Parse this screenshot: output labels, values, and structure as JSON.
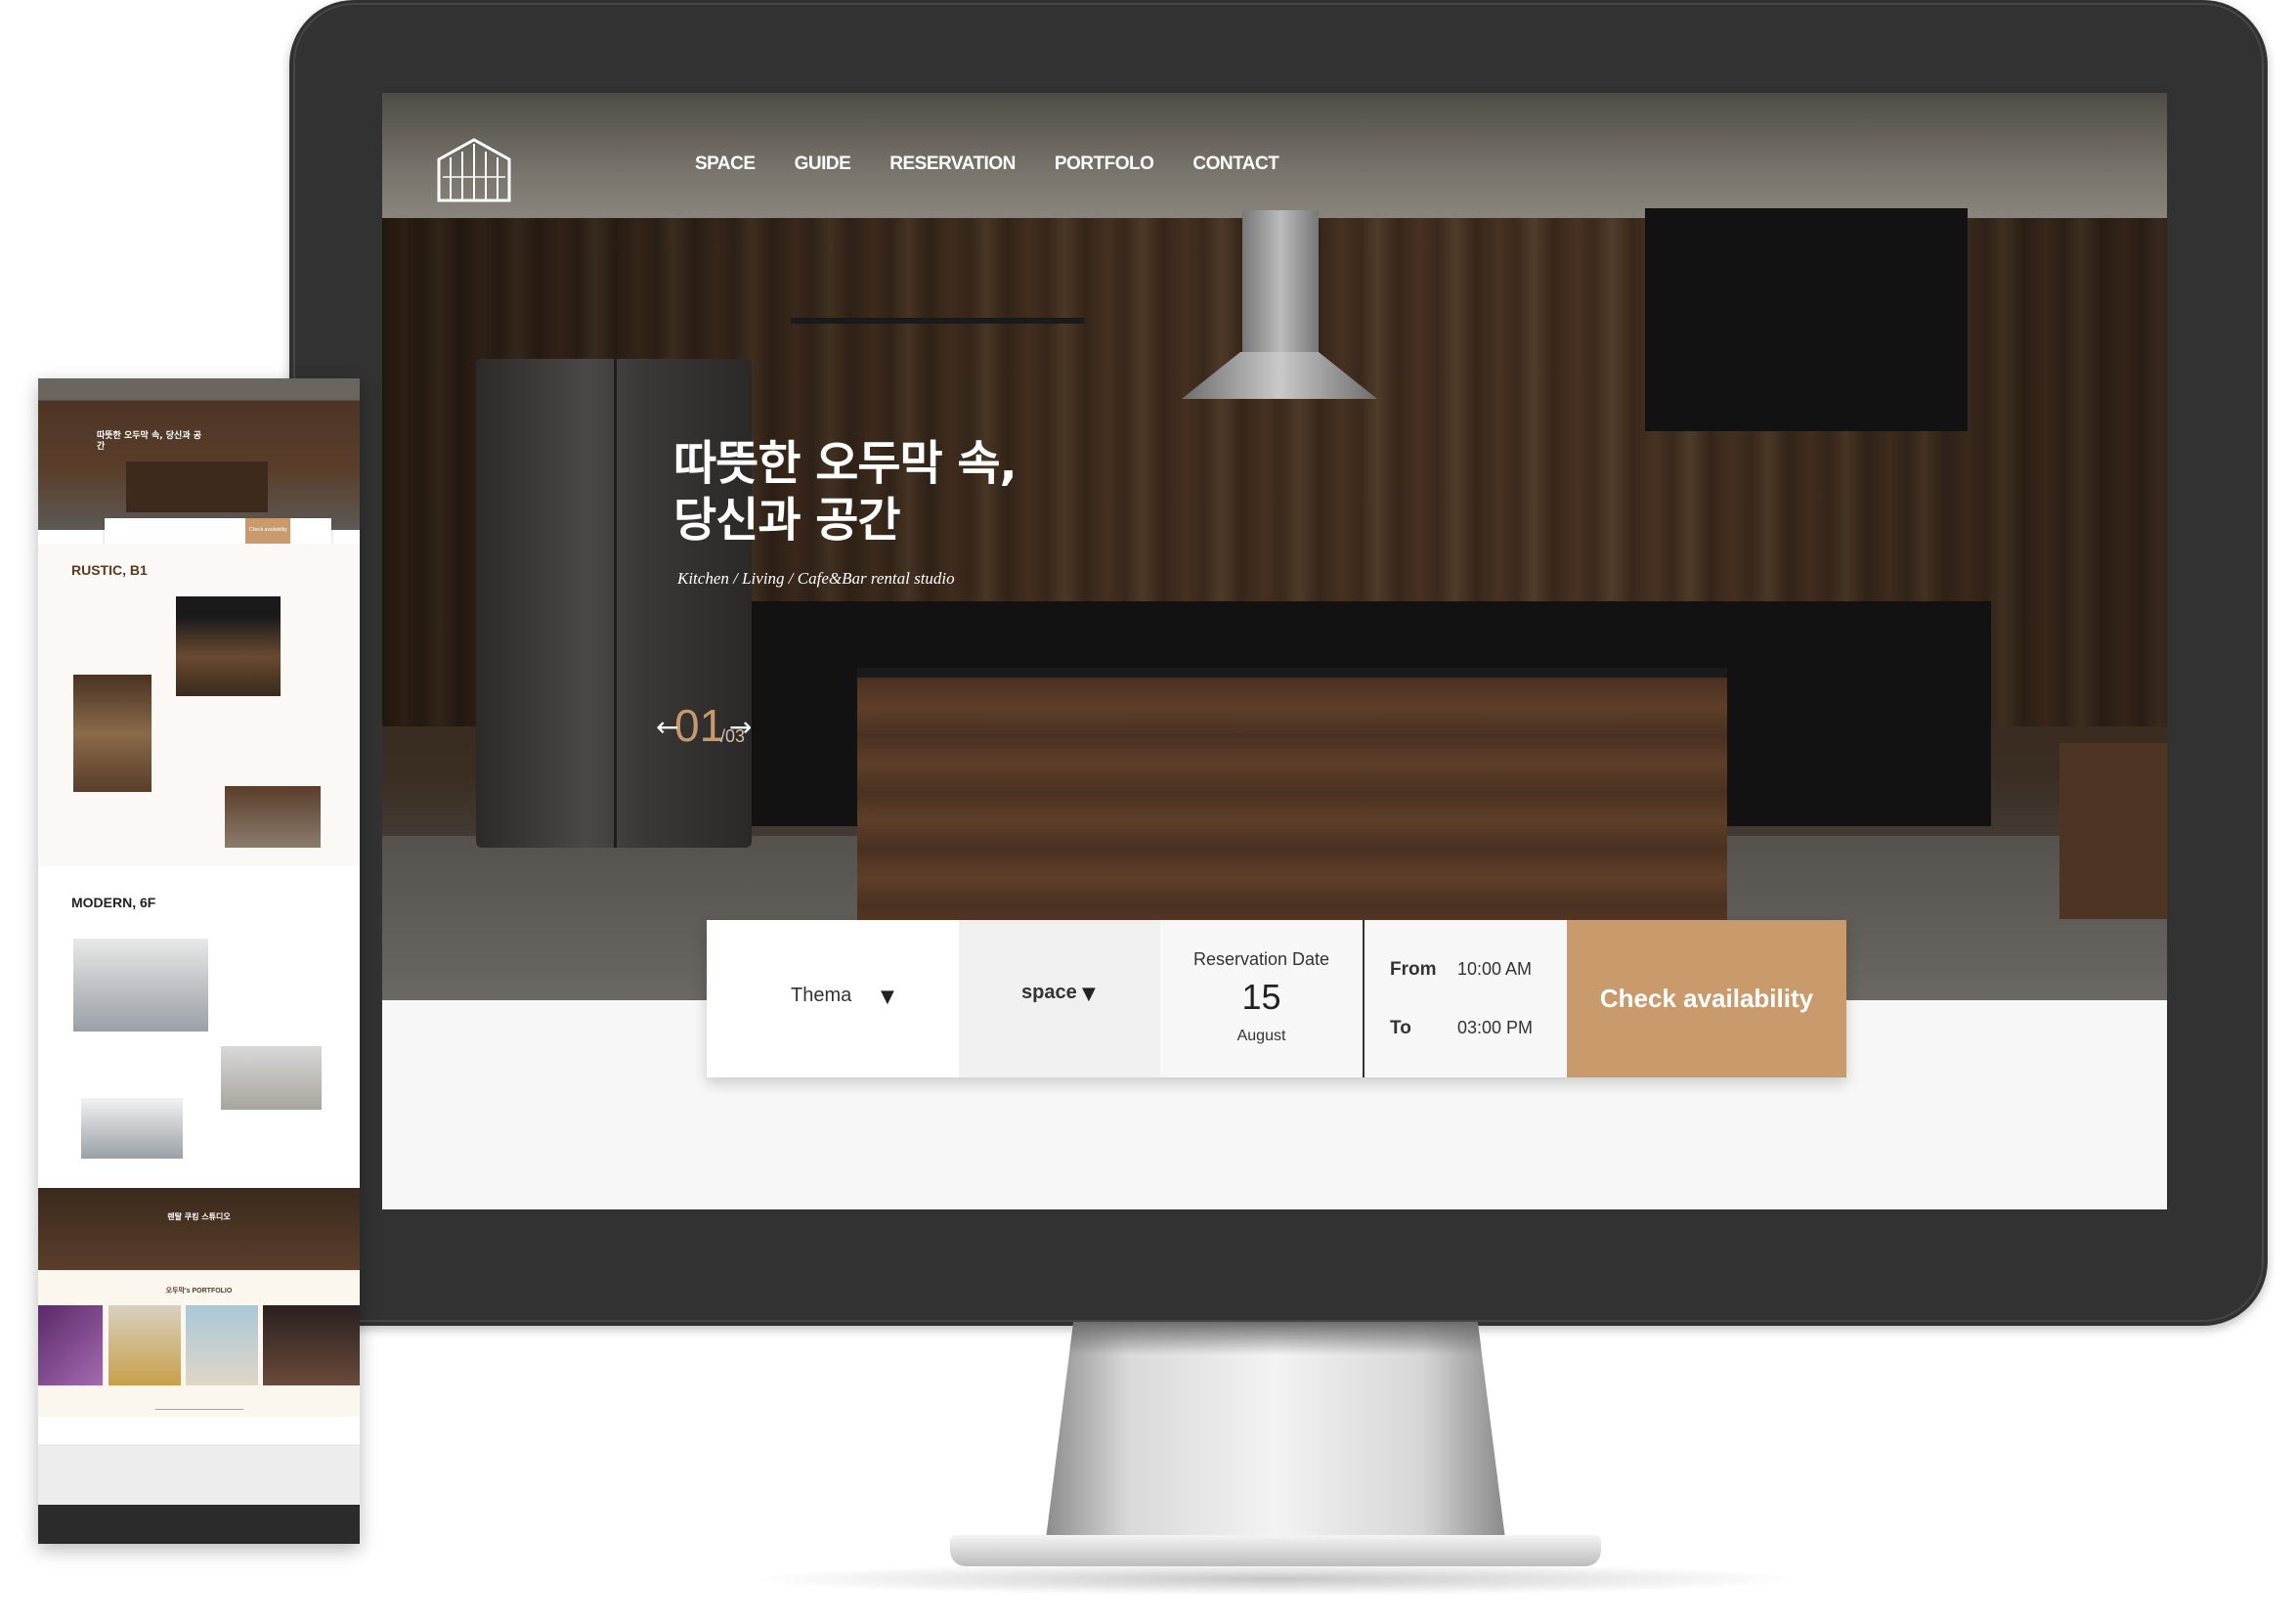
{
  "nav": {
    "items": [
      "SPACE",
      "GUIDE",
      "RESERVATION",
      "PORTFOLO",
      "CONTACT"
    ]
  },
  "hero": {
    "title_line1": "따뜻한 오두막 속,",
    "title_line2": "당신과 공간",
    "subtitle": "Kitchen / Living / Cafe&Bar rental studio",
    "slide_current": "01",
    "slide_total": "/03",
    "prev_arrow": "←",
    "next_arrow": "→"
  },
  "reservation": {
    "thema_label": "Thema",
    "space_label": "space",
    "dropdown_glyph": "▼",
    "date_label": "Reservation Date",
    "date_day": "15",
    "date_month": "August",
    "from_label": "From",
    "from_time": "10:00 AM",
    "to_label": "To",
    "to_time": "03:00 PM",
    "check_button": "Check availability"
  },
  "mobile": {
    "hero_title": "따뜻한 오두막 속, 당신과 공간",
    "check_button": "Check availability",
    "section1_title": "RUSTIC, B1",
    "section2_title": "MODERN, 6F",
    "band_title": "렌탈 쿠킹 스튜디오",
    "portfolio_title": "오두막's PORTFOLIO"
  },
  "colors": {
    "accent": "#c99a6c",
    "monitor_bezel": "#323232",
    "dark_text": "#333333"
  }
}
